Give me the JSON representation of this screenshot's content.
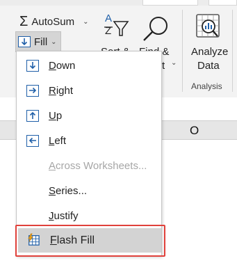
{
  "ribbon": {
    "autosum_label": "AutoSum",
    "fill_label": "Fill",
    "sort_label": "Sort &",
    "find_label_1": "Find &",
    "find_label_2": "t",
    "analyze_label_1": "Analyze",
    "analyze_label_2": "Data",
    "analysis_group_label": "Analysis",
    "sigma_glyph": "Σ",
    "sort_glyph_top": "A",
    "sort_glyph_bottom": "Z"
  },
  "sheet": {
    "column_letter": "O"
  },
  "fill_menu": {
    "items": [
      {
        "key": "down",
        "first": "D",
        "rest": "own",
        "icon": "fill-down-icon"
      },
      {
        "key": "right",
        "first": "R",
        "rest": "ight",
        "icon": "fill-right-icon"
      },
      {
        "key": "up",
        "first": "U",
        "rest": "p",
        "icon": "fill-up-icon"
      },
      {
        "key": "left",
        "first": "L",
        "rest": "eft",
        "icon": "fill-left-icon"
      },
      {
        "key": "across",
        "first": "A",
        "rest": "cross Worksheets...",
        "disabled": true
      },
      {
        "key": "series",
        "first": "S",
        "rest": "eries..."
      },
      {
        "key": "justify",
        "first": "J",
        "rest": "ustify"
      },
      {
        "key": "flash",
        "first": "F",
        "rest": "lash Fill",
        "icon": "flash-fill-icon",
        "highlighted": true
      }
    ]
  },
  "colors": {
    "icon_blue": "#1f5fa8",
    "highlight_red": "#e0413b",
    "highlight_bg": "#d3d3d3"
  }
}
